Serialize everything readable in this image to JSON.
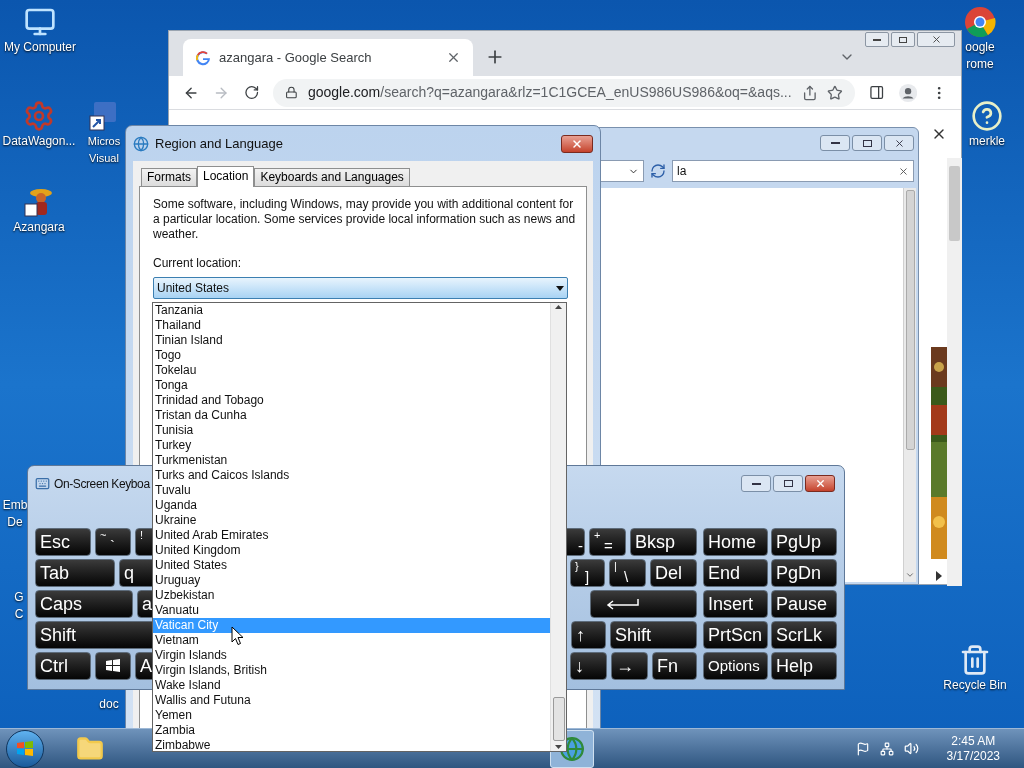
{
  "desktop_icons": [
    {
      "kind": "computer",
      "lines": [
        "My Computer"
      ]
    },
    {
      "kind": "gear",
      "lines": [
        "DataWagon..."
      ]
    },
    {
      "kind": "vb",
      "lines": [
        "Micros",
        "Visual"
      ]
    },
    {
      "kind": "game",
      "lines": [
        "Azangara"
      ]
    },
    {
      "kind": "chrome",
      "lines": [
        "oogle",
        "rome"
      ]
    },
    {
      "kind": "help",
      "lines": [
        "merkle"
      ]
    },
    {
      "kind": "recycle",
      "lines": [
        "Recycle Bin"
      ]
    },
    {
      "kind": "none",
      "lines": [
        "Emb",
        "De"
      ]
    },
    {
      "kind": "none",
      "lines": [
        "G",
        "C"
      ]
    },
    {
      "kind": "none",
      "lines": [
        "doc"
      ]
    }
  ],
  "browser": {
    "tab_title": "azangara - Google Search",
    "forward_disabled": true,
    "url_host": "google.com",
    "url_path": "/search?q=azangara&rlz=1C1GCEA_enUS986US986&oq=&aqs...",
    "search_value": "la"
  },
  "dialog": {
    "title": "Region and Language",
    "tabs": [
      {
        "label": "Formats",
        "selected": false
      },
      {
        "label": "Location",
        "selected": true
      },
      {
        "label": "Keyboards and Languages",
        "selected": false
      }
    ],
    "description": "Some software, including Windows, may provide you with additional content for a particular location. Some services provide local information such as news and weather.",
    "location_label": "Current location:",
    "location": "United States",
    "options": [
      {
        "label": "Tanzania",
        "selected": false
      },
      {
        "label": "Thailand",
        "selected": false
      },
      {
        "label": "Tinian Island",
        "selected": false
      },
      {
        "label": "Togo",
        "selected": false
      },
      {
        "label": "Tokelau",
        "selected": false
      },
      {
        "label": "Tonga",
        "selected": false
      },
      {
        "label": "Trinidad and Tobago",
        "selected": false
      },
      {
        "label": "Tristan da Cunha",
        "selected": false
      },
      {
        "label": "Tunisia",
        "selected": false
      },
      {
        "label": "Turkey",
        "selected": false
      },
      {
        "label": "Turkmenistan",
        "selected": false
      },
      {
        "label": "Turks and Caicos Islands",
        "selected": false
      },
      {
        "label": "Tuvalu",
        "selected": false
      },
      {
        "label": "Uganda",
        "selected": false
      },
      {
        "label": "Ukraine",
        "selected": false
      },
      {
        "label": "United Arab Emirates",
        "selected": false
      },
      {
        "label": "United Kingdom",
        "selected": false
      },
      {
        "label": "United States",
        "selected": false
      },
      {
        "label": "Uruguay",
        "selected": false
      },
      {
        "label": "Uzbekistan",
        "selected": false
      },
      {
        "label": "Vanuatu",
        "selected": false
      },
      {
        "label": "Vatican City",
        "selected": true
      },
      {
        "label": "Vietnam",
        "selected": false
      },
      {
        "label": "Virgin Islands",
        "selected": false
      },
      {
        "label": "Virgin Islands, British",
        "selected": false
      },
      {
        "label": "Wake Island",
        "selected": false
      },
      {
        "label": "Wallis and Futuna",
        "selected": false
      },
      {
        "label": "Yemen",
        "selected": false
      },
      {
        "label": "Zambia",
        "selected": false
      },
      {
        "label": "Zimbabwe",
        "selected": false
      }
    ]
  },
  "keyboard": {
    "title": "On-Screen Keyboa",
    "rows": [
      {
        "left": [
          {
            "kind": "text",
            "label": "Esc"
          },
          {
            "kind": "dual",
            "top": "~",
            "bottom": "`"
          },
          {
            "kind": "dual",
            "top": "!"
          }
        ],
        "right": [
          {
            "kind": "dual",
            "bottom": "-"
          },
          {
            "kind": "dual",
            "top": "+",
            "bottom": "="
          },
          {
            "kind": "text",
            "label": "Bksp"
          }
        ],
        "nav": [
          {
            "kind": "text",
            "label": "Home"
          },
          {
            "kind": "text",
            "label": "PgUp"
          }
        ]
      },
      {
        "left": [
          {
            "kind": "text",
            "label": "Tab"
          },
          {
            "kind": "text",
            "label": "q"
          }
        ],
        "right": [
          {
            "kind": "dual",
            "top": "}",
            "bottom": "]"
          },
          {
            "kind": "dual",
            "top": "|",
            "bottom": "\\"
          },
          {
            "kind": "text",
            "label": "Del"
          }
        ],
        "nav": [
          {
            "kind": "text",
            "label": "End"
          },
          {
            "kind": "text",
            "label": "PgDn"
          }
        ]
      },
      {
        "left": [
          {
            "kind": "text",
            "label": "Caps"
          },
          {
            "kind": "text",
            "label": "a"
          }
        ],
        "right": [
          {
            "kind": "enter"
          }
        ],
        "nav": [
          {
            "kind": "text",
            "label": "Insert"
          },
          {
            "kind": "text",
            "label": "Pause"
          }
        ]
      },
      {
        "left": [
          {
            "kind": "text",
            "label": "Shift"
          }
        ],
        "right": [
          {
            "kind": "text",
            "label": "↑"
          },
          {
            "kind": "text",
            "label": "Shift"
          }
        ],
        "nav": [
          {
            "kind": "text",
            "label": "PrtScn"
          },
          {
            "kind": "text",
            "label": "ScrLk"
          }
        ]
      },
      {
        "left": [
          {
            "kind": "text",
            "label": "Ctrl"
          },
          {
            "kind": "windows"
          },
          {
            "kind": "text",
            "label": "A"
          }
        ],
        "right": [
          {
            "kind": "text",
            "label": "↓"
          },
          {
            "kind": "text",
            "label": "→"
          },
          {
            "kind": "text",
            "label": "Fn"
          }
        ],
        "nav": [
          {
            "kind": "text",
            "label": "Options"
          },
          {
            "kind": "text",
            "label": "Help"
          }
        ]
      }
    ]
  },
  "taskbar": {
    "buttons": [
      {
        "kind": "explorer",
        "active": false
      },
      {
        "kind": "globe",
        "active": true
      }
    ],
    "time": "2:45 AM",
    "date": "3/17/2023"
  }
}
